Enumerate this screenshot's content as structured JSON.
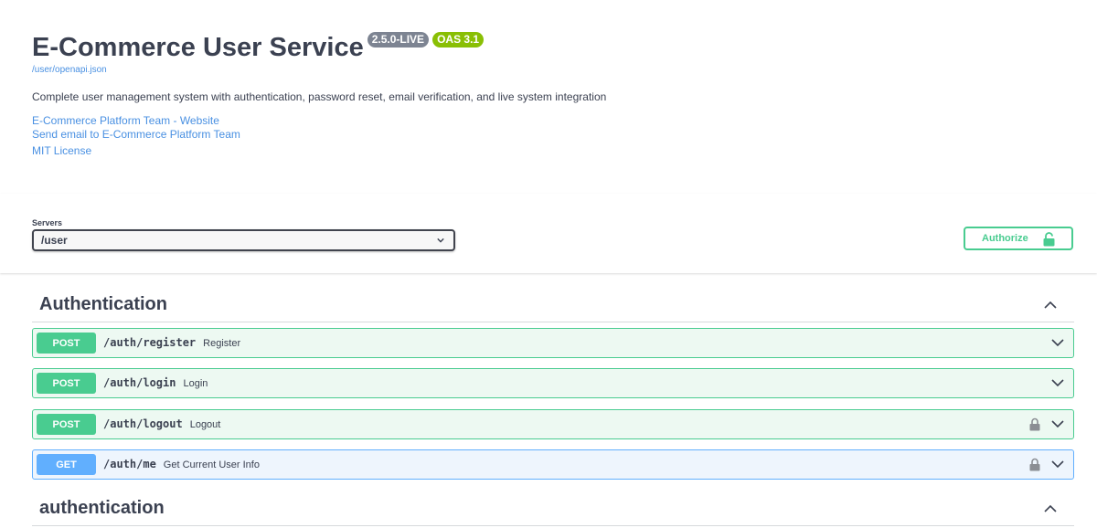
{
  "info": {
    "title": "E-Commerce User Service",
    "version_badge": "2.5.0-LIVE",
    "oas_badge": "OAS 3.1",
    "spec_link": "/user/openapi.json",
    "description": "Complete user management system with authentication, password reset, email verification, and live system integration",
    "contact_website": "E-Commerce Platform Team - Website",
    "contact_email": "Send email to E-Commerce Platform Team",
    "license": "MIT License"
  },
  "servers": {
    "label": "Servers",
    "selected": "/user"
  },
  "authorize": {
    "label": "Authorize"
  },
  "tags": [
    {
      "name": "Authentication",
      "operations": [
        {
          "method": "POST",
          "path": "/auth/register",
          "summary": "Register",
          "locked": false
        },
        {
          "method": "POST",
          "path": "/auth/login",
          "summary": "Login",
          "locked": false
        },
        {
          "method": "POST",
          "path": "/auth/logout",
          "summary": "Logout",
          "locked": true
        },
        {
          "method": "GET",
          "path": "/auth/me",
          "summary": "Get Current User Info",
          "locked": true
        }
      ]
    },
    {
      "name": "authentication",
      "operations": []
    }
  ],
  "colors": {
    "post": "#49cc90",
    "get": "#61affe",
    "link": "#4990e2"
  }
}
